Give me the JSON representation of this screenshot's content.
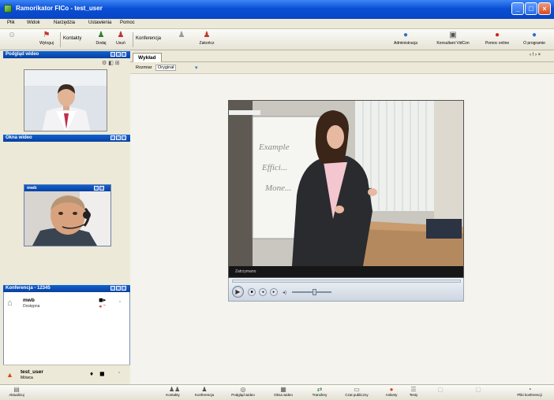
{
  "window": {
    "title": "Ramorikator FICo - test_user",
    "minimize": "_",
    "maximize": "□",
    "close": "×"
  },
  "menu": [
    "Plik",
    "Widok",
    "Narzędzia",
    "Ustawienia",
    "Pomoc"
  ],
  "toolbar": {
    "left": [
      {
        "label": "Wyloguj",
        "icon": "logout-icon"
      },
      {
        "label": "Dodaj",
        "icon": "add-contact-icon"
      },
      {
        "label": "Usuń",
        "icon": "remove-contact-icon"
      },
      {
        "label": "Zakończ",
        "icon": "end-conference-icon"
      }
    ],
    "groups": {
      "contacts": "Kontakty",
      "conference": "Konferencja"
    },
    "right": [
      {
        "label": "Administracja",
        "icon": "admin-icon"
      },
      {
        "label": "Konsultant VidCon",
        "icon": "consultant-icon"
      },
      {
        "label": "Pomoc online",
        "icon": "help-online-icon"
      },
      {
        "label": "O programie",
        "icon": "about-icon"
      }
    ]
  },
  "panels": {
    "preview": {
      "title": "Podgląd wideo"
    },
    "video_window": {
      "title": "Okna wideo",
      "inner_title": "mwb"
    },
    "conference": {
      "title": "Konferencja - 12345",
      "participant_name": "mwb",
      "participant_status": "Dostępna",
      "user_name": "test_user",
      "user_status": "Mówca"
    }
  },
  "main": {
    "tab": "Wykład",
    "tab_controls": "‹ ! › ×",
    "sub_label": "Rozmiar",
    "sub_value": "Oryginał",
    "video_status": "Zatrzymano",
    "whiteboard_lines": [
      "Example",
      "Effici...",
      "Mone..."
    ]
  },
  "bottombar": {
    "left_label": "Aktualizuj",
    "buttons": [
      {
        "label": "Kontakty",
        "icon": "contacts-icon"
      },
      {
        "label": "Konferencja",
        "icon": "conference-icon"
      },
      {
        "label": "Podgląd wideo",
        "icon": "video-preview-icon"
      },
      {
        "label": "Okna wideo",
        "icon": "video-windows-icon"
      },
      {
        "label": "Transfery",
        "icon": "transfer-icon"
      },
      {
        "label": "Czat publiczny",
        "icon": "chat-icon"
      },
      {
        "label": "Ankiety",
        "icon": "poll-icon"
      },
      {
        "label": "Testy",
        "icon": "tests-icon"
      }
    ],
    "right_label": "Pliki konferencji"
  }
}
